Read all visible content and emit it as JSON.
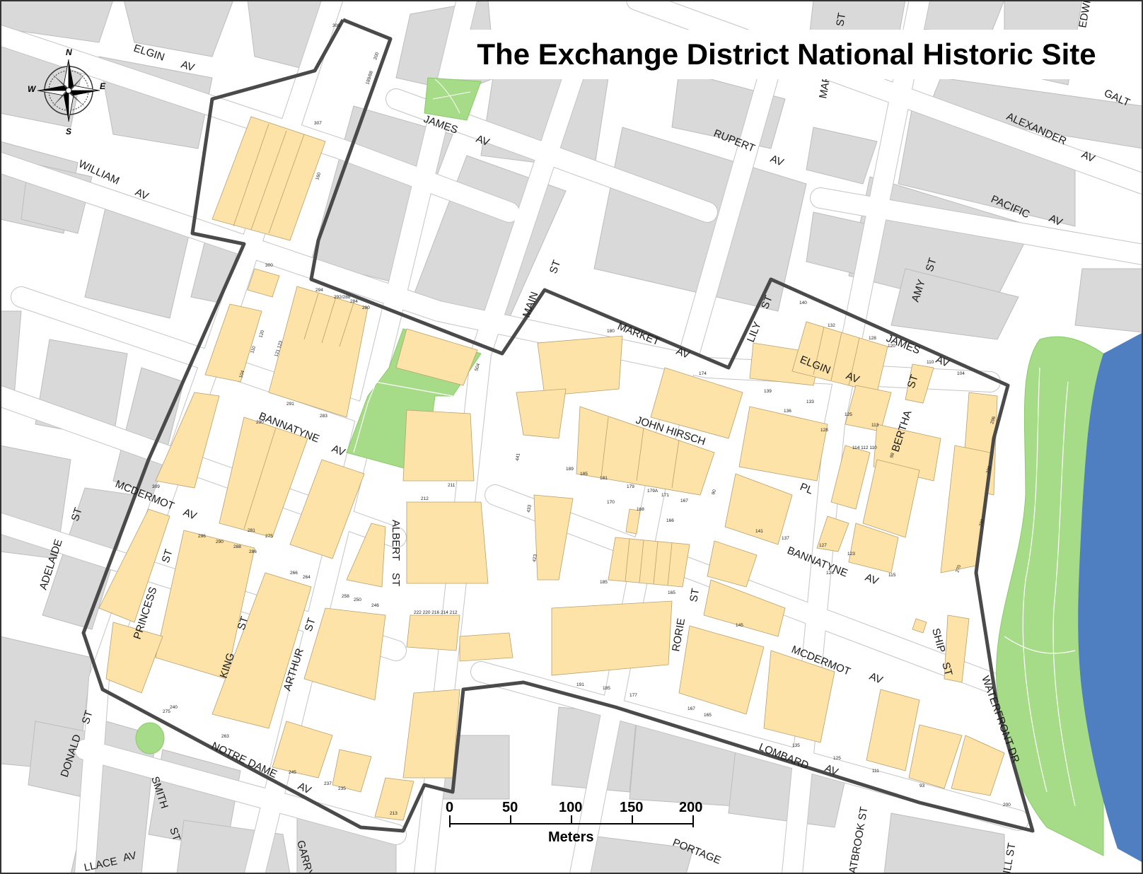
{
  "title": "The Exchange District National Historic Site",
  "colors": {
    "background": "#ffffff",
    "block": "#d9d9d9",
    "historic_building": "#fde3a7",
    "park": "#a6dc87",
    "river": "#4f7fc0",
    "boundary": "#4a4a4a",
    "street_casing": "#bfbfbf"
  },
  "compass": {
    "north": "N",
    "south": "S",
    "east": "E",
    "west": "W",
    "icon": "compass-rose-icon"
  },
  "scale_bar": {
    "ticks": [
      "0",
      "50",
      "100",
      "150",
      "200"
    ],
    "unit": "Meters"
  },
  "streets": {
    "elgin_av_w_1": "ELGIN",
    "elgin_av_w_2": "AV",
    "william_av_1": "WILLIAM",
    "william_av_2": "AV",
    "james_av_1": "JAMES",
    "james_av_2": "AV",
    "rupert_av_1": "RUPERT",
    "rupert_av_2": "AV",
    "alexander_av_1": "ALEXANDER",
    "alexander_av_2": "AV",
    "galt": "GALT",
    "pacific_av_1": "PACIFIC",
    "pacific_av_2": "AV",
    "main_st_1": "MAIN",
    "main_st_2": "ST",
    "market_av_1": "MARKET",
    "market_av_2": "AV",
    "lily_st_1": "LILY",
    "lily_st_2": "ST",
    "amy_st_1": "AMY",
    "amy_st_2": "ST",
    "james_av_e_1": "JAMES",
    "james_av_e_2": "AV",
    "elgin_av_e_1": "ELGIN",
    "elgin_av_e_2": "AV",
    "bertha_st_1": "BERTHA",
    "bertha_st_2": "ST",
    "john_hirsch": "JOHN HIRSCH",
    "pl": "PL",
    "bannatyne_av_w_1": "BANNATYNE",
    "bannatyne_av_w_2": "AV",
    "bannatyne_av_e_1": "BANNATYNE",
    "bannatyne_av_e_2": "AV",
    "mcdermot_av_w_1": "MCDERMOT",
    "mcdermot_av_w_2": "AV",
    "mcdermot_av_e_1": "MCDERMOT",
    "mcdermot_av_e_2": "AV",
    "albert_st_1": "ALBERT",
    "albert_st_2": "ST",
    "princess_st_1": "PRINCESS",
    "princess_st_2": "ST",
    "king_st_1": "KING",
    "king_st_2": "ST",
    "arthur_st_1": "ARTHUR",
    "arthur_st_2": "ST",
    "rorie_st_1": "RORIE",
    "rorie_st_2": "ST",
    "ship_st_1": "SHIP",
    "ship_st_2": "ST",
    "waterfront_dr": "WATERFRONT DR",
    "lombard_av_1": "LOMBARD",
    "lombard_av_2": "AV",
    "adelaide_st_1": "ADELAIDE",
    "adelaide_st_2": "ST",
    "donald_st_1": "DONALD",
    "donald_st_2": "ST",
    "smith_st_1": "SMITH",
    "smith_st_2": "ST",
    "notre_dame_av_1": "NOTRE DAME",
    "notre_dame_av_2": "AV",
    "portage": "PORTAGE",
    "garry": "GARRY",
    "wallace_av_1": "LLACE",
    "wallace_av_2": "AV",
    "westbrook_st": "ATBROOK ST",
    "hill_st": "ILL ST",
    "martha": "MAR",
    "st_top": "ST",
    "edwin": "EDWIN"
  },
  "addresses": {
    "a300_top": "300",
    "a200": "200",
    "a189": "189/88",
    "a307": "307",
    "a160": "160",
    "a300": "300",
    "a294": "294",
    "a292": "292/288",
    "a284": "284",
    "a280": "280",
    "a180": "180",
    "a174": "174",
    "a504": "504",
    "a132": "132",
    "a128": "128",
    "a120": "120",
    "a140": "140",
    "a110": "110",
    "a104": "104",
    "a139": "139",
    "a133": "133",
    "a125": "125",
    "a113": "113",
    "a136": "136",
    "a128b": "128",
    "a114": "114 112 110",
    "a98": "98",
    "a189b": "189",
    "a185": "185",
    "a181": "181",
    "a179": "179",
    "a179a": "179A",
    "a171": "171",
    "a167": "167",
    "a90": "90",
    "a211": "211",
    "a212": "212",
    "a170": "170",
    "a168": "168",
    "a166": "166",
    "a441": "441",
    "a433": "433",
    "a423": "423",
    "a185b": "185",
    "a165": "165",
    "a145": "145",
    "a141": "141",
    "a137": "137",
    "a127": "127",
    "a123": "123",
    "a124": "124",
    "a115": "115",
    "a270": "270",
    "a280b": "280",
    "a290": "290",
    "a296": "296",
    "a240": "240",
    "a275": "275",
    "a263": "263",
    "a245": "245",
    "a237": "237",
    "a235": "235",
    "a213": "213",
    "a191": "191",
    "a185c": "185",
    "a177": "177",
    "a167b": "167",
    "a165b": "165",
    "a135": "135",
    "a125b": "125",
    "a111": "111",
    "a93": "93",
    "a200b": "200",
    "a222": "222 220 216 214 212",
    "a258": "258",
    "a250": "250",
    "a246": "246",
    "a266": "266",
    "a264": "264",
    "a296b": "296",
    "a290b": "290",
    "a288": "288",
    "a286": "286",
    "a281": "281",
    "a275b": "275",
    "a291": "291",
    "a283": "283",
    "a290c": "290",
    "a309": "309",
    "a104b": "104",
    "a110b": "110",
    "a120b": "120",
    "a121": "121 123"
  }
}
